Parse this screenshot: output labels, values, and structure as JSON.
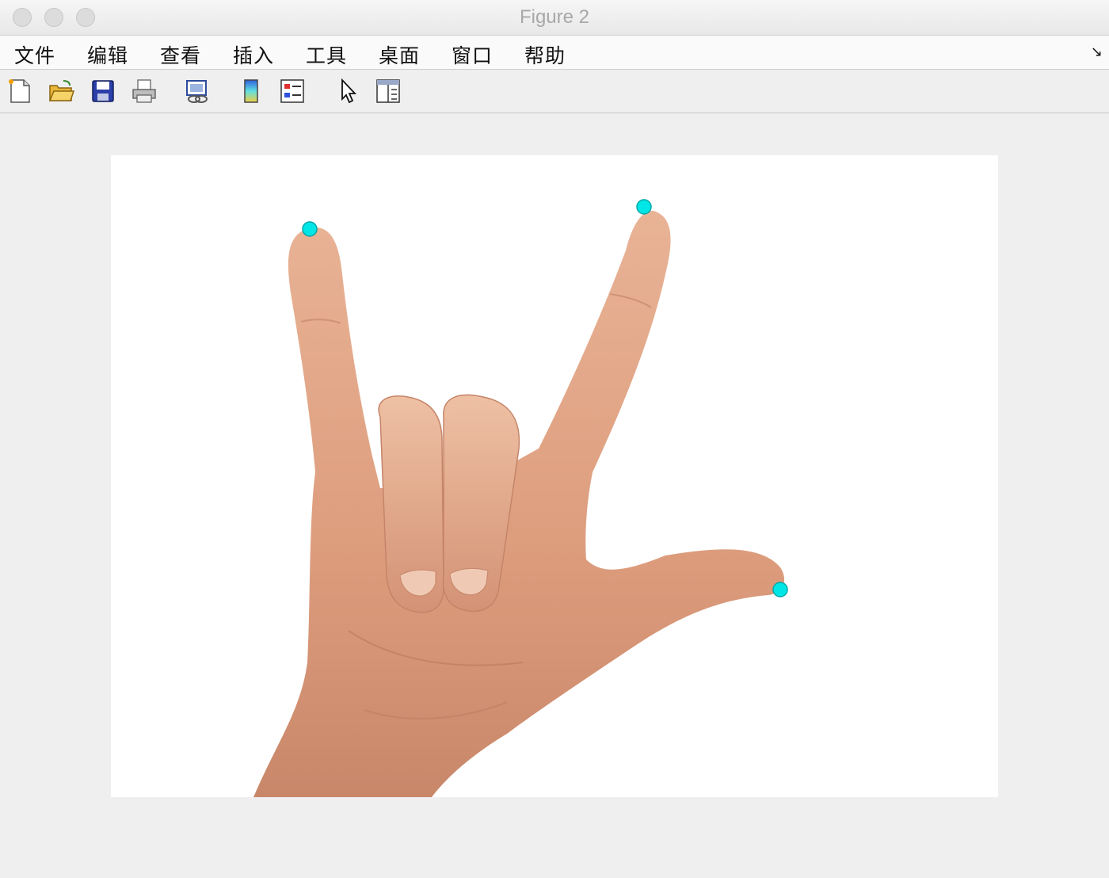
{
  "window": {
    "title": "Figure 2"
  },
  "menu": {
    "items": [
      "文件",
      "编辑",
      "查看",
      "插入",
      "工具",
      "桌面",
      "窗口",
      "帮助"
    ],
    "corner_icon": "dock-arrow-icon"
  },
  "toolbar": {
    "buttons": [
      "new-figure-icon",
      "open-file-icon",
      "save-icon",
      "print-icon",
      "link-plot-icon",
      "colorbar-icon",
      "legend-icon",
      "pointer-icon",
      "property-editor-icon"
    ]
  },
  "figure": {
    "content": "photo of a hand showing the I-love-you sign",
    "markers": [
      {
        "label": "index fingertip",
        "color": "#00e5e5"
      },
      {
        "label": "pinky fingertip",
        "color": "#00e5e5"
      },
      {
        "label": "thumb tip",
        "color": "#00e5e5"
      }
    ],
    "colors": {
      "skin": "#e0a483",
      "marker": "#00e5e5",
      "canvas": "#efefef"
    }
  }
}
